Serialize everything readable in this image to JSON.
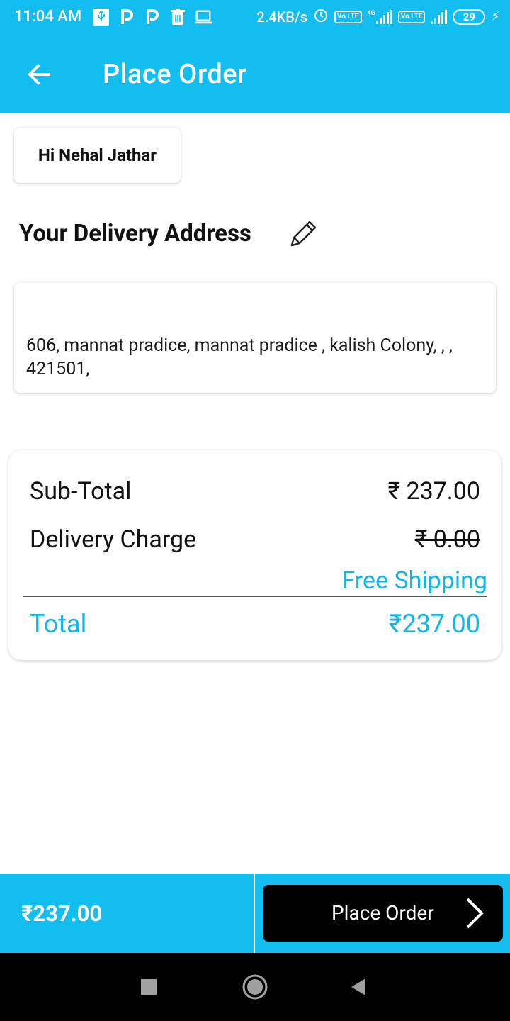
{
  "status_bar": {
    "time": "11:04 AM",
    "network_speed": "2.4KB/s",
    "network_badge_1": "Vo LTE",
    "network_badge_2": "Vo LTE",
    "network_type": "4G",
    "battery": "29",
    "left_icons": [
      "usb-icon",
      "paytm-p-icon",
      "paytm-p-icon",
      "trash-icon",
      "laptop-icon"
    ]
  },
  "app_bar": {
    "title": "Place Order",
    "back_icon": "arrow-left-icon"
  },
  "greeting": {
    "text": "Hi Nehal Jathar"
  },
  "address": {
    "heading": "Your Delivery Address",
    "edit_icon": "pencil-icon",
    "text": "606, mannat pradice, mannat pradice , kalish Colony, , , 421501,"
  },
  "totals": {
    "subtotal_label": "Sub-Total",
    "subtotal_value": "₹ 237.00",
    "delivery_label": "Delivery Charge",
    "delivery_value": "₹ 0.00",
    "free_shipping": "Free Shipping",
    "total_label": "Total",
    "total_value": "₹237.00"
  },
  "bottom_bar": {
    "amount": "₹237.00",
    "place_order_label": "Place Order"
  },
  "colors": {
    "accent": "#12bdf0",
    "accent_text": "#12b6e6",
    "button_bg": "#000000"
  },
  "nav_bar": {
    "buttons": [
      "recent-apps-icon",
      "home-icon",
      "back-icon"
    ]
  }
}
